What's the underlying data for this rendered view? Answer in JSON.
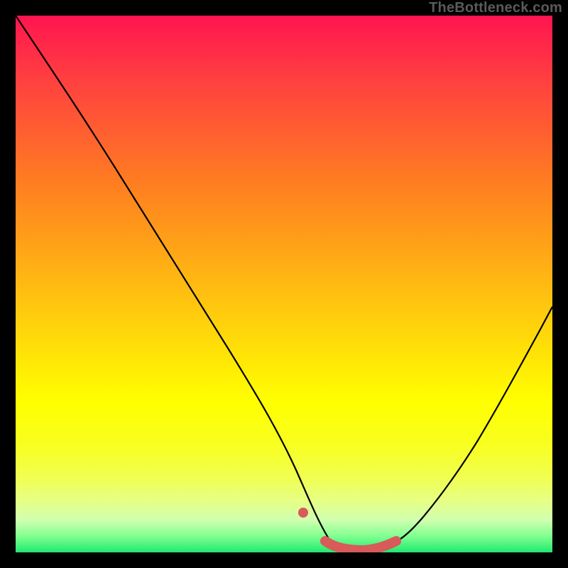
{
  "watermark": "TheBottleneck.com",
  "colors": {
    "background": "#000000",
    "gradient_top": "#ff1450",
    "gradient_mid": "#ffff00",
    "gradient_bottom": "#20e870",
    "curve": "#000000",
    "marker": "#d85a5a"
  },
  "chart_data": {
    "type": "line",
    "title": "",
    "xlabel": "",
    "ylabel": "",
    "xlim": [
      0,
      100
    ],
    "ylim": [
      0,
      100
    ],
    "grid": false,
    "legend": false,
    "series": [
      {
        "name": "bottleneck-curve",
        "x": [
          0,
          5,
          10,
          15,
          20,
          25,
          30,
          35,
          40,
          45,
          50,
          53,
          57,
          62,
          66,
          70,
          75,
          80,
          85,
          90,
          95,
          100
        ],
        "values": [
          100,
          93,
          85,
          76,
          67,
          59,
          50,
          41,
          32,
          23,
          14,
          8,
          3,
          0,
          0,
          0,
          2,
          8,
          17,
          27,
          38,
          49
        ]
      }
    ],
    "annotations": [
      {
        "name": "marker-left-dot",
        "type": "point",
        "x": 53.5,
        "y": 7
      },
      {
        "name": "marker-trough",
        "type": "thick-segment",
        "x": [
          58,
          71
        ],
        "values": [
          2,
          2
        ]
      }
    ]
  }
}
